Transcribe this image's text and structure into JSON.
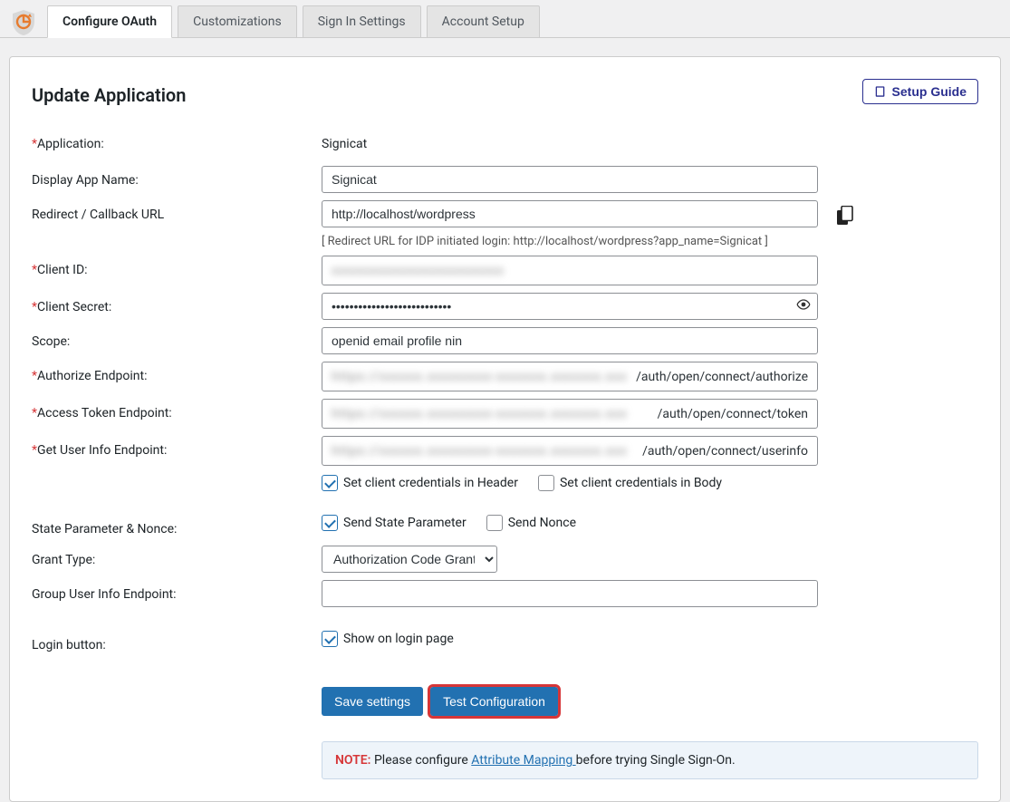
{
  "tabs": {
    "configure": "Configure OAuth",
    "customizations": "Customizations",
    "signin": "Sign In Settings",
    "account": "Account Setup"
  },
  "heading": "Update Application",
  "setup_guide": "Setup Guide",
  "labels": {
    "application": "Application:",
    "display_name": "Display App Name:",
    "redirect": "Redirect / Callback URL",
    "client_id": "Client ID:",
    "client_secret": "Client Secret:",
    "scope": "Scope:",
    "authorize_ep": "Authorize Endpoint:",
    "token_ep": "Access Token Endpoint:",
    "userinfo_ep": "Get User Info Endpoint:",
    "state_nonce": "State Parameter & Nonce:",
    "grant_type": "Grant Type:",
    "group_userinfo": "Group User Info Endpoint:",
    "login_button": "Login button:"
  },
  "values": {
    "application": "Signicat",
    "display_name": "Signicat",
    "redirect": "http://localhost/wordpress",
    "redirect_hint": "[ Redirect URL for IDP initiated login: http://localhost/wordpress?app_name=Signicat ]",
    "client_secret_mask": "•••••••••••••••••••••••••••",
    "scope": "openid email profile nin",
    "authorize_suffix": "/auth/open/connect/authorize",
    "token_suffix": "/auth/open/connect/token",
    "userinfo_suffix": "/auth/open/connect/userinfo",
    "grant_type": "Authorization Code Grant",
    "group_userinfo": ""
  },
  "checkboxes": {
    "cred_header": "Set client credentials in Header",
    "cred_body": "Set client credentials in Body",
    "send_state": "Send State Parameter",
    "send_nonce": "Send Nonce",
    "show_login": "Show on login page"
  },
  "buttons": {
    "save": "Save settings",
    "test": "Test Configuration"
  },
  "note": {
    "label": "NOTE:",
    "before": "  Please configure ",
    "link": "Attribute Mapping ",
    "after": "before trying Single Sign-On."
  }
}
